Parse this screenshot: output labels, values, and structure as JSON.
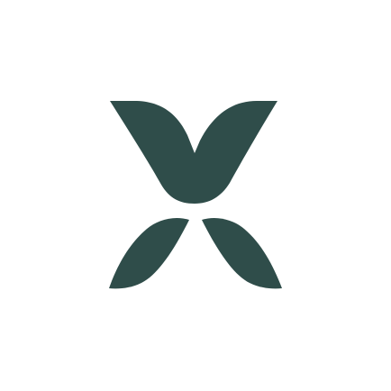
{
  "logo": {
    "icon": "abstract-x-leaf-logo",
    "color": "#2F4D4A",
    "background": "#FFFFFF"
  }
}
